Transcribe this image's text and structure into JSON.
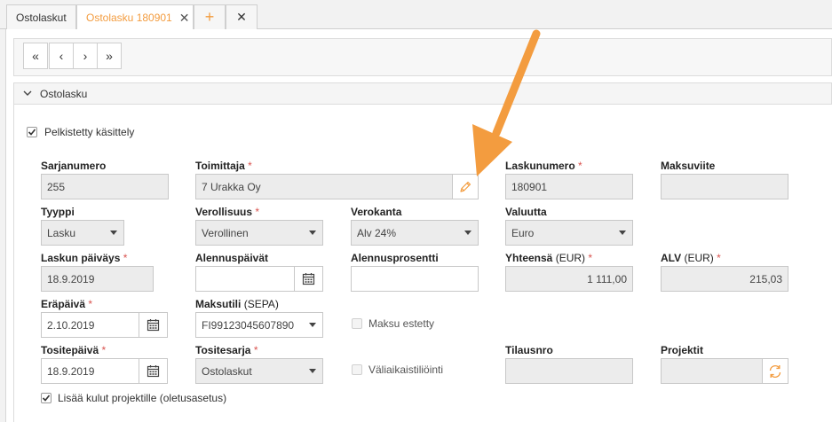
{
  "tabs": [
    {
      "label": "Ostolaskut"
    },
    {
      "label": "Ostolasku 180901",
      "close": "✕"
    },
    {
      "label": "+"
    },
    {
      "label": "✕"
    }
  ],
  "nav": {
    "first": "«",
    "prev": "‹",
    "next": "›",
    "last": "»"
  },
  "section": {
    "title": "Ostolasku"
  },
  "simplified": {
    "label": "Pelkistetty käsittely",
    "checked": true
  },
  "fields": {
    "sarjanumero": {
      "label": "Sarjanumero",
      "value": "255"
    },
    "toimittaja": {
      "label": "Toimittaja",
      "required": "*",
      "value": "7 Urakka Oy"
    },
    "laskunumero": {
      "label": "Laskunumero",
      "required": "*",
      "value": "180901"
    },
    "maksuviite": {
      "label": "Maksuviite",
      "value": ""
    },
    "tyyppi": {
      "label": "Tyyppi",
      "value": "Lasku"
    },
    "verollisuus": {
      "label": "Verollisuus",
      "required": "*",
      "value": "Verollinen"
    },
    "verokanta": {
      "label": "Verokanta",
      "value": "Alv 24%"
    },
    "valuutta": {
      "label": "Valuutta",
      "value": "Euro"
    },
    "laskun_paivays": {
      "label": "Laskun päiväys",
      "required": "*",
      "value": "18.9.2019"
    },
    "alennuspaivat": {
      "label": "Alennuspäivät",
      "value": ""
    },
    "alennusprosentti": {
      "label": "Alennusprosentti",
      "value": ""
    },
    "yhteensa": {
      "label": "Yhteensä",
      "unit": " (EUR)",
      "required": "*",
      "value": "1 111,00"
    },
    "alv": {
      "label": "ALV",
      "unit": " (EUR)",
      "required": "*",
      "value": "215,03"
    },
    "erapaiva": {
      "label": "Eräpäivä",
      "required": "*",
      "value": "2.10.2019"
    },
    "maksutili": {
      "label": "Maksutili",
      "unit": " (SEPA)",
      "value": "FI99123045607890"
    },
    "maksu_estetty": {
      "label": "Maksu estetty",
      "checked": false
    },
    "tositepaiva": {
      "label": "Tositepäivä",
      "required": "*",
      "value": "18.9.2019"
    },
    "tositesarja": {
      "label": "Tositesarja",
      "required": "*",
      "value": "Ostolaskut"
    },
    "valiaikaistiliointi": {
      "label": "Väliaikaistiliöinti",
      "checked": false
    },
    "tilausnro": {
      "label": "Tilausnro",
      "value": ""
    },
    "projektit": {
      "label": "Projektit",
      "value": ""
    }
  },
  "lisaa_kulut": {
    "label": "Lisää kulut projektille (oletusasetus)",
    "checked": true
  },
  "colors": {
    "accent": "#f39c3f",
    "required": "#d9534f",
    "arrow": "#f39c3f"
  }
}
